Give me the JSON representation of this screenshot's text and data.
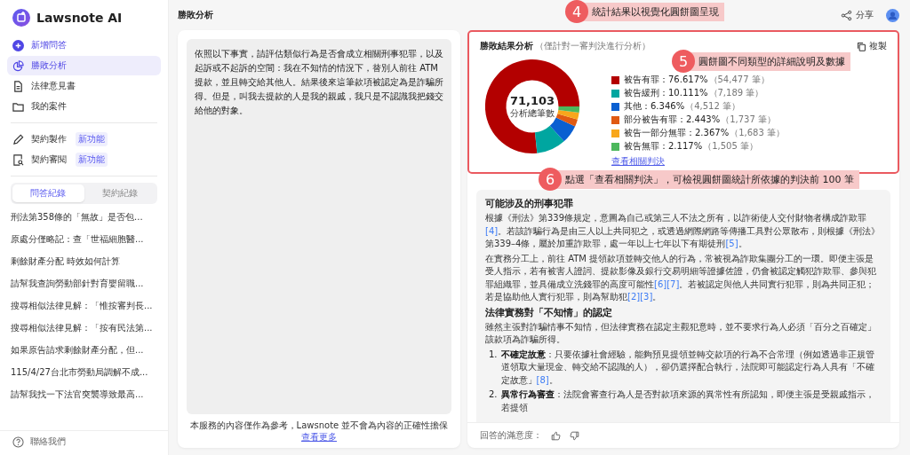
{
  "app": {
    "name": "Lawsnote AI"
  },
  "nav": [
    {
      "label": "新增問答",
      "selected": false,
      "accent": true
    },
    {
      "label": "勝敗分析",
      "selected": true,
      "accent": false
    },
    {
      "label": "法律意見書",
      "selected": false,
      "accent": false
    },
    {
      "label": "我的案件",
      "selected": false,
      "accent": false
    }
  ],
  "tools": [
    {
      "label": "契約製作",
      "badge": "新功能"
    },
    {
      "label": "契約審閱",
      "badge": "新功能"
    }
  ],
  "history_tabs": [
    {
      "label": "問答紀錄",
      "selected": true
    },
    {
      "label": "契約紀錄",
      "selected": false
    }
  ],
  "history": [
    "刑法第358條的「無故」是否包...",
    "原處分僅略記：查「世福細胞醫...",
    "剩餘財產分配 時效如何計算",
    "請幫我查詢勞動部針對育嬰留職...",
    "搜尋相似法律見解：「惟按審判長...",
    "搜尋相似法律見解：「按有民法第...",
    "如果原告請求剩餘財產分配，但...",
    "115/4/27台北市勞動局調解不成...",
    "請幫我找一下法官突襲導致最高..."
  ],
  "contact": "聯絡我們",
  "header": {
    "title": "勝敗分析",
    "share": "分享"
  },
  "question": "依照以下事實，請評估類似行為是否會成立相關刑事犯罪，以及起訴或不起訴的空間：我在不知情的情況下，替別人前往 ATM 提款，並且轉交給其他人。結果後來這筆款項被認定為是詐騙所得。但是，叫我去提款的人是我的親戚，我只是不認識我把錢交給他的對象。",
  "disclaimer": {
    "text": "本服務的內容僅作為參考，Lawsnote 並不會為內容的正確性擔保",
    "link": "查看更多"
  },
  "analysis": {
    "title": "勝敗結果分析",
    "subtitle": "（僅計對一審判決進行分析）",
    "copy": "複製",
    "total": "71,103",
    "total_label": "分析總筆數",
    "link": "查看相關判決",
    "legend": [
      {
        "value": "：76.617%",
        "count": "（54,477 筆）",
        "color": "#b30000"
      },
      {
        "value": "：10.111%",
        "count": "（7,189 筆）",
        "color": "#00a6a0"
      },
      {
        "value": "：6.346%",
        "count": "（4,512 筆）",
        "color": "#0a5fd1"
      },
      {
        "value": "：2.443%",
        "count": "（1,737 筆）",
        "color": "#e05a13"
      },
      {
        "value": "：2.367%",
        "count": "（1,683 筆）",
        "color": "#f8a71c"
      },
      {
        "value": "：2.117%",
        "count": "（1,505 筆）",
        "color": "#4cb85c"
      }
    ],
    "chart_data": {
      "type": "donut",
      "categories": [
        "被告有罪",
        "被告緩刑",
        "其他",
        "部分被告有罪",
        "被告一部分無罪",
        "被告無罪"
      ],
      "values": [
        76.617,
        10.111,
        6.346,
        2.443,
        2.367,
        2.117
      ]
    }
  },
  "answer": [
    {
      "kind": "heading",
      "text": "可能涉及的刑事犯罪"
    },
    {
      "kind": "para",
      "parts": [
        {
          "kind": "text",
          "text": "根據《刑法》第339條規定，意圖為自己或第三人不法之所有，以詐術使人交付財物者構成詐欺罪"
        },
        {
          "kind": "ref",
          "text": "[4]"
        },
        {
          "kind": "text",
          "text": "。若該詐騙行為是由三人以上共同犯之，或透過網際網路等傳播工具對公眾散布，則根據《刑法》第339–4條，屬於加重詐欺罪，處一年以上七年以下有期徒刑"
        },
        {
          "kind": "ref",
          "text": "[5]"
        },
        {
          "kind": "text",
          "text": "。"
        }
      ]
    },
    {
      "kind": "para",
      "parts": [
        {
          "kind": "text",
          "text": "在實務分工上，前往 ATM 提領款項並轉交他人的行為，常被視為詐欺集團分工的一環。即便主張是受人指示，若有被害人證詞、提款影像及銀行交易明細等證據佐證，仍會被認定觸犯詐欺罪、參與犯罪組織罪，並具備成立洗錢罪的高度可能性"
        },
        {
          "kind": "ref",
          "text": "[6][7]"
        },
        {
          "kind": "text",
          "text": "。若被認定與他人共同實行犯罪，則為共同正犯；若是協助他人實行犯罪，則為幫助犯"
        },
        {
          "kind": "ref",
          "text": "[2][3]"
        },
        {
          "kind": "text",
          "text": "。"
        }
      ]
    },
    {
      "kind": "heading",
      "text": "法律實務對「不知情」的認定"
    },
    {
      "kind": "para",
      "parts": [
        {
          "kind": "text",
          "text": "雖然主張對詐騙情事不知情，但法律實務在認定主觀犯意時，並不要求行為人必須「百分之百確定」該款項為詐騙所得。"
        }
      ]
    },
    {
      "kind": "item",
      "number": "1.",
      "parts": [
        {
          "kind": "bold",
          "text": "不確定故意"
        },
        {
          "kind": "text",
          "text": "：只要依據社會經驗，能夠預見提領並轉交款項的行為不合常理（例如透過非正規管道領取大量現金、轉交給不認識的人），卻仍選擇配合執行，法院即可能認定行為人具有「不確定故意」"
        },
        {
          "kind": "ref",
          "text": "[8]"
        },
        {
          "kind": "text",
          "text": "。"
        }
      ]
    },
    {
      "kind": "item",
      "number": "2.",
      "parts": [
        {
          "kind": "bold",
          "text": "異常行為審查"
        },
        {
          "kind": "text",
          "text": "：法院會審查行為人是否對款項來源的異常性有所認知，即便主張是受親戚指示，若提領"
        }
      ]
    }
  ],
  "feedback": "回答的滿意度：",
  "callouts": [
    {
      "number": "4",
      "text": "統計結果以視覺化圓餅圖呈現"
    },
    {
      "number": "5",
      "text": "圓餅圖不同類型的詳細說明及數據"
    },
    {
      "number": "6",
      "text": "點選「查看相關判決」，可檢視圓餅圖統計所依據的判決前 100 筆"
    }
  ]
}
